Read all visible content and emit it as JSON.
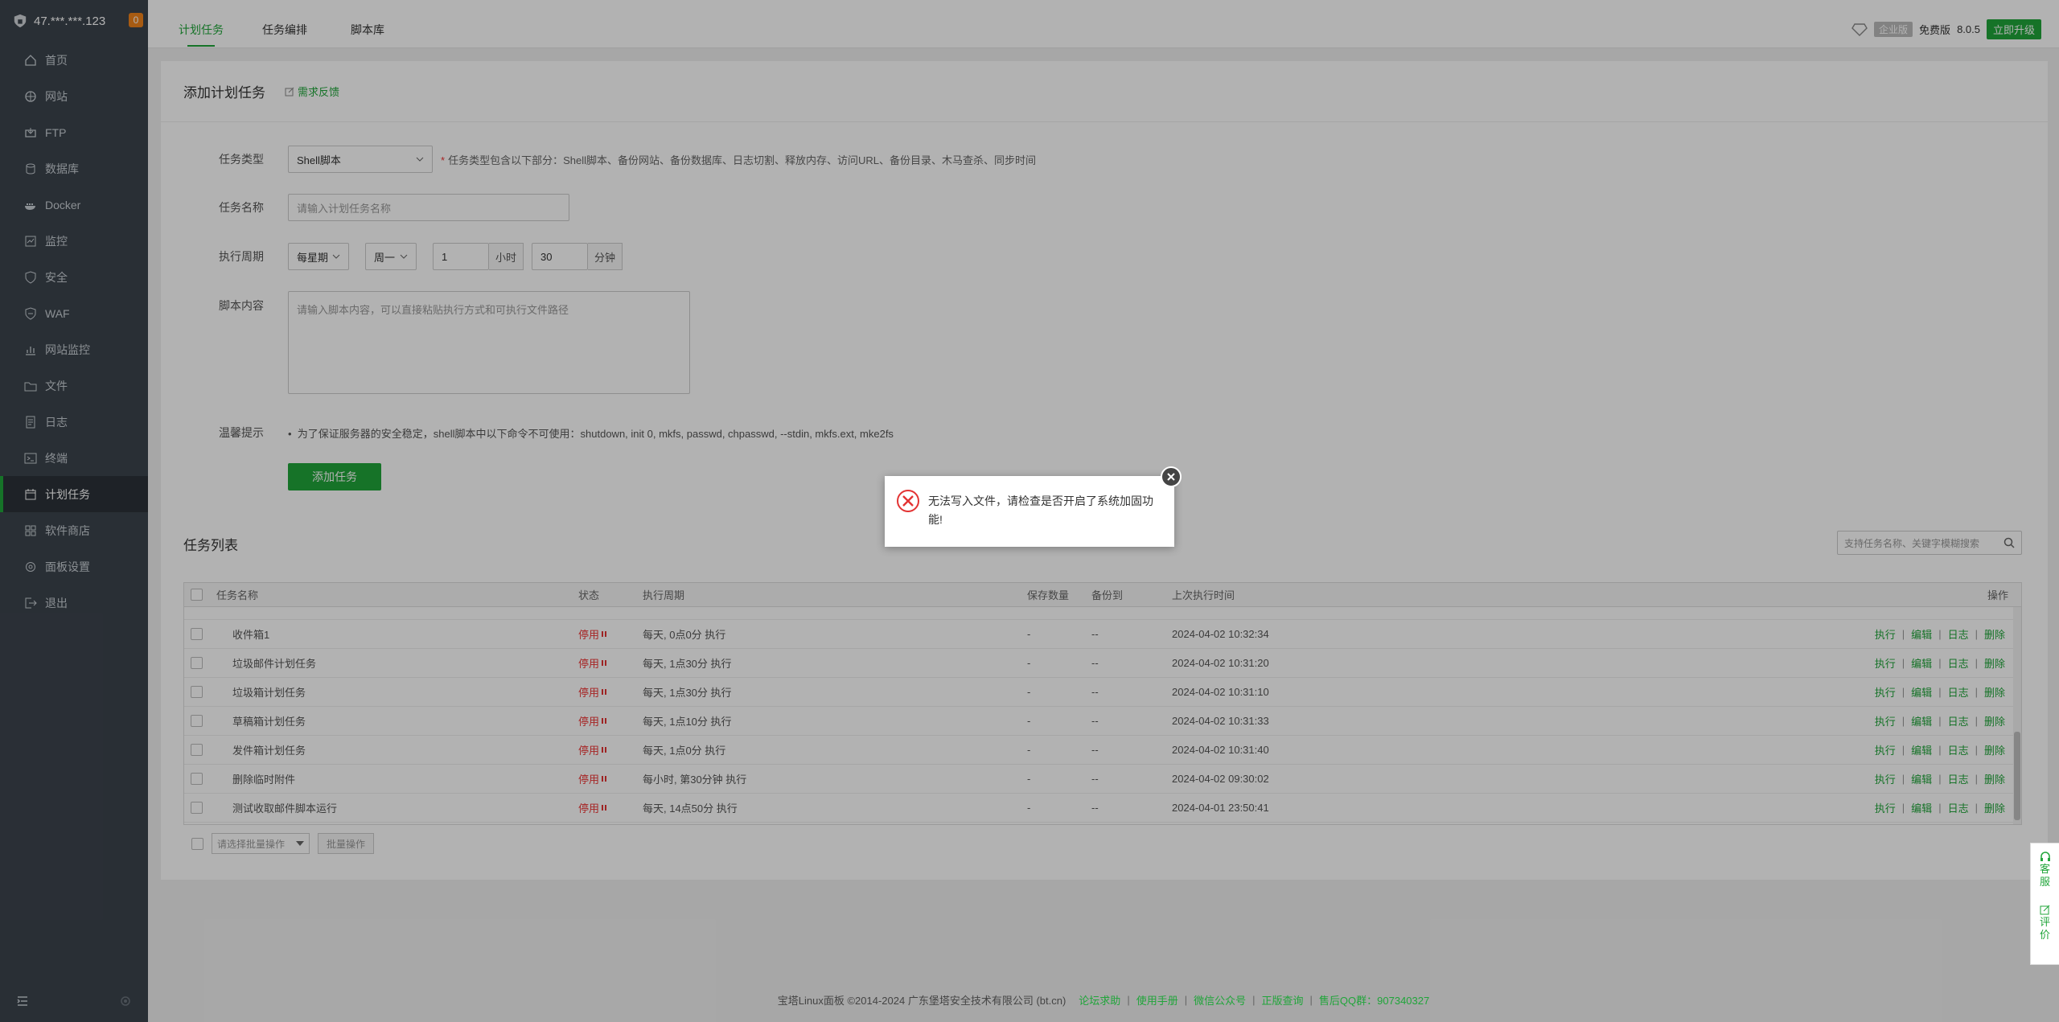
{
  "server": {
    "ip": "47.***.***.123",
    "badge": "0"
  },
  "sidebar": {
    "items": [
      {
        "label": "首页",
        "icon": "home-icon"
      },
      {
        "label": "网站",
        "icon": "globe-icon"
      },
      {
        "label": "FTP",
        "icon": "ftp-icon"
      },
      {
        "label": "数据库",
        "icon": "database-icon"
      },
      {
        "label": "Docker",
        "icon": "docker-icon"
      },
      {
        "label": "监控",
        "icon": "monitor-icon"
      },
      {
        "label": "安全",
        "icon": "shield-icon"
      },
      {
        "label": "WAF",
        "icon": "waf-icon"
      },
      {
        "label": "网站监控",
        "icon": "site-monitor-icon"
      },
      {
        "label": "文件",
        "icon": "folder-icon"
      },
      {
        "label": "日志",
        "icon": "log-icon"
      },
      {
        "label": "终端",
        "icon": "terminal-icon"
      },
      {
        "label": "计划任务",
        "icon": "calendar-icon"
      },
      {
        "label": "软件商店",
        "icon": "store-icon"
      },
      {
        "label": "面板设置",
        "icon": "settings-icon"
      },
      {
        "label": "退出",
        "icon": "logout-icon"
      }
    ],
    "active_index": 12
  },
  "tabs": [
    "计划任务",
    "任务编排",
    "脚本库"
  ],
  "topright": {
    "enterprise": "企业版",
    "free": "免费版",
    "version": "8.0.5",
    "upgrade": "立即升级"
  },
  "add_task": {
    "title": "添加计划任务",
    "feedback": "需求反馈",
    "type_label": "任务类型",
    "type_value": "Shell脚本",
    "type_hint": "任务类型包含以下部分：Shell脚本、备份网站、备份数据库、日志切割、释放内存、访问URL、备份目录、木马查杀、同步时间",
    "name_label": "任务名称",
    "name_placeholder": "请输入计划任务名称",
    "period_label": "执行周期",
    "period_value": "每星期",
    "weekday_value": "周一",
    "hour_value": "1",
    "hour_unit": "小时",
    "minute_value": "30",
    "minute_unit": "分钟",
    "script_label": "脚本内容",
    "script_placeholder": "请输入脚本内容，可以直接粘贴执行方式和可执行文件路径",
    "tips_label": "温馨提示",
    "tips_text": "为了保证服务器的安全稳定，shell脚本中以下命令不可使用：shutdown, init 0, mkfs, passwd, chpasswd, --stdin, mkfs.ext, mke2fs",
    "submit": "添加任务"
  },
  "task_list": {
    "title": "任务列表",
    "search_placeholder": "支持任务名称、关键字模糊搜索",
    "columns": [
      "任务名称",
      "状态",
      "执行周期",
      "保存数量",
      "备份到",
      "上次执行时间",
      "操作"
    ],
    "rows": [
      {
        "name": "收件箱1",
        "status": "停用",
        "period": "每天, 0点0分 执行",
        "keep": "-",
        "backup": "--",
        "last": "2024-04-02 10:32:34"
      },
      {
        "name": "垃圾邮件计划任务",
        "status": "停用",
        "period": "每天, 1点30分 执行",
        "keep": "-",
        "backup": "--",
        "last": "2024-04-02 10:31:20"
      },
      {
        "name": "垃圾箱计划任务",
        "status": "停用",
        "period": "每天, 1点30分 执行",
        "keep": "-",
        "backup": "--",
        "last": "2024-04-02 10:31:10"
      },
      {
        "name": "草稿箱计划任务",
        "status": "停用",
        "period": "每天, 1点10分 执行",
        "keep": "-",
        "backup": "--",
        "last": "2024-04-02 10:31:33"
      },
      {
        "name": "发件箱计划任务",
        "status": "停用",
        "period": "每天, 1点0分 执行",
        "keep": "-",
        "backup": "--",
        "last": "2024-04-02 10:31:40"
      },
      {
        "name": "删除临时附件",
        "status": "停用",
        "period": "每小时, 第30分钟 执行",
        "keep": "-",
        "backup": "--",
        "last": "2024-04-02 09:30:02"
      },
      {
        "name": "测试收取邮件脚本运行",
        "status": "停用",
        "period": "每天, 14点50分 执行",
        "keep": "-",
        "backup": "--",
        "last": "2024-04-01 23:50:41"
      }
    ],
    "ops": [
      "执行",
      "编辑",
      "日志",
      "删除"
    ],
    "batch_placeholder": "请选择批量操作",
    "batch_button": "批量操作"
  },
  "dialog": {
    "message": "无法写入文件，请检查是否开启了系统加固功能!"
  },
  "float": {
    "service": "客服",
    "rate": "评价"
  },
  "footer": {
    "copyright": "宝塔Linux面板 ©2014-2024 广东堡塔安全技术有限公司 (bt.cn)",
    "links": [
      "论坛求助",
      "使用手册",
      "微信公众号",
      "正版查询",
      "售后QQ群：907340327"
    ]
  },
  "colors": {
    "brand": "#20a53a",
    "danger": "#e33333",
    "sidebar": "#3c444d"
  }
}
